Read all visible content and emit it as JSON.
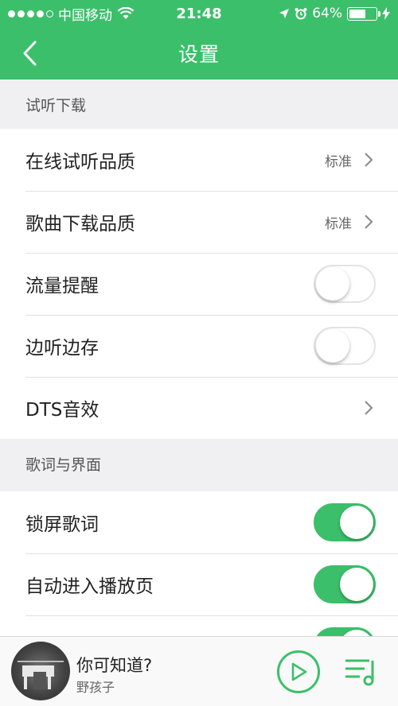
{
  "status_bar": {
    "carrier": "中国移动",
    "time": "21:48",
    "battery": "64%",
    "battery_level": 0.64
  },
  "nav": {
    "title": "设置"
  },
  "sections": {
    "trial_download": {
      "header": "试听下载",
      "online_quality": {
        "label": "在线试听品质",
        "value": "标准"
      },
      "download_quality": {
        "label": "歌曲下载品质",
        "value": "标准"
      },
      "data_alert": {
        "label": "流量提醒",
        "on": false
      },
      "listen_save": {
        "label": "边听边存",
        "on": false
      },
      "dts": {
        "label": "DTS音效"
      }
    },
    "lyrics_ui": {
      "header": "歌词与界面",
      "lockscreen_lyrics": {
        "label": "锁屏歌词",
        "on": true
      },
      "auto_play_page": {
        "label": "自动进入播放页",
        "on": true
      },
      "partial_row": {
        "on": true
      }
    }
  },
  "player": {
    "song_title": "你可知道?",
    "artist": "野孩子"
  },
  "colors": {
    "accent": "#3cbf6a",
    "background": "#f0f0f2"
  },
  "icons": [
    "signal-dots-icon",
    "wifi-icon",
    "location-icon",
    "alarm-icon",
    "battery-icon",
    "charging-icon",
    "back-chevron-icon",
    "chevron-right-icon",
    "play-icon",
    "playlist-icon"
  ]
}
